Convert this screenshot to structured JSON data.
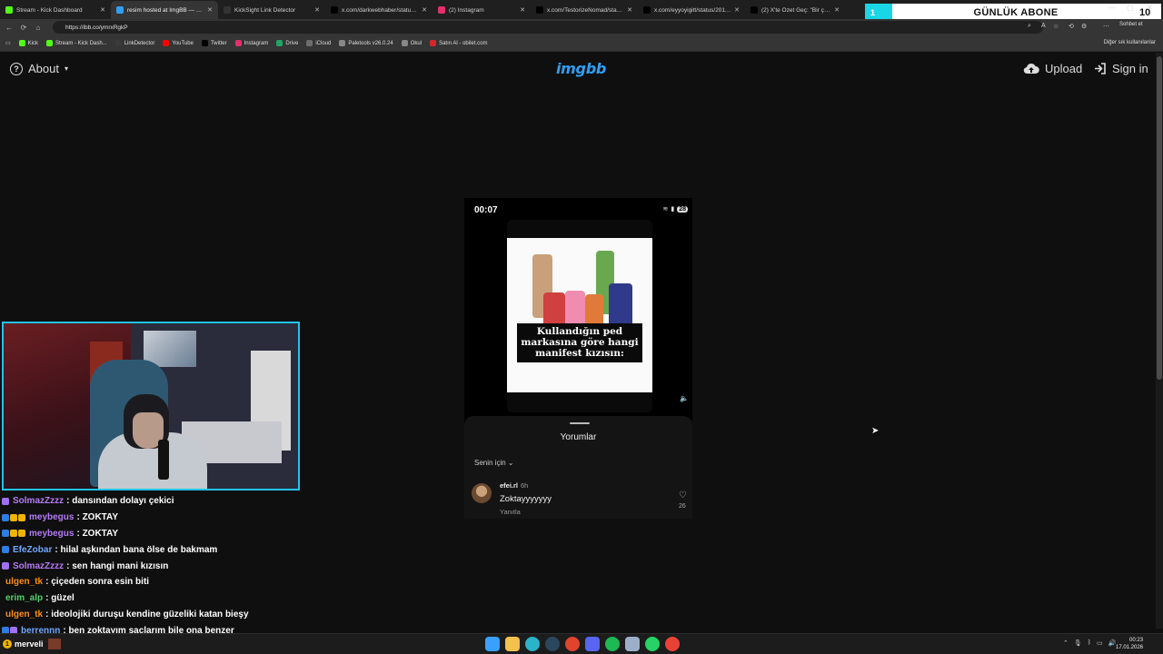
{
  "browser": {
    "tabs": [
      {
        "title": "Stream - Kick Dashboard",
        "fav_color": "#53fc18",
        "active": false
      },
      {
        "title": "resim hosted at ImgBB — ImgBB",
        "fav_color": "#2f9ff5",
        "active": true
      },
      {
        "title": "KickSight Link Detector",
        "fav_color": "#333333",
        "active": false
      },
      {
        "title": "x.com/darkwebhaber/status/2011",
        "fav_color": "#000000",
        "active": false
      },
      {
        "title": "(2) Instagram",
        "fav_color": "#e1306c",
        "active": false
      },
      {
        "title": "x.com/TestorizeNomad/status/201",
        "fav_color": "#000000",
        "active": false
      },
      {
        "title": "x.com/eyyoyigitt/status/2011378",
        "fav_color": "#000000",
        "active": false
      },
      {
        "title": "(2) X'te Özet Geç: \"Bir çift, \"Squid",
        "fav_color": "#000000",
        "active": false
      }
    ],
    "url": "https://ibb.co/ymrxRgkP",
    "sohbet_label": "Sohbet et",
    "bookmarks": [
      {
        "label": "Kick",
        "color": "#53fc18"
      },
      {
        "label": "Stream - Kick Dash...",
        "color": "#53fc18"
      },
      {
        "label": "LinkDetector",
        "color": "#3a3a3a"
      },
      {
        "label": "YouTube",
        "color": "#ff0000"
      },
      {
        "label": "Twitter",
        "color": "#000000"
      },
      {
        "label": "Instagram",
        "color": "#e1306c"
      },
      {
        "label": "Drive",
        "color": "#1fa463"
      },
      {
        "label": "iCloud",
        "color": "#6d6d6d"
      },
      {
        "label": "Paletools v26.0.24",
        "color": "#888888"
      },
      {
        "label": "Okul",
        "color": "#888888"
      },
      {
        "label": "Satın Al - obilet.com",
        "color": "#d6262d"
      }
    ],
    "other_bookmarks": "Diğer sık kullanılanlar"
  },
  "abone": {
    "label": "GÜNLÜK ABONE",
    "left_value": "1",
    "count": "10"
  },
  "imgbb": {
    "about_label": "About",
    "logo": "imgbb",
    "upload_label": "Upload",
    "signin_label": "Sign in"
  },
  "phone": {
    "time": "00:07",
    "battery": "28",
    "reel_caption": "Kullandığın ped markasına göre hangi manifest kızısın:",
    "sheet_title": "Yorumlar",
    "sort_label": "Senin için",
    "comment": {
      "user": "efei.rl",
      "time": "6h",
      "text": "Zoktayyyyyyy",
      "reply": "Yanıtla",
      "likes": "26"
    }
  },
  "chat": [
    {
      "user": "SolmazZzzz",
      "color": "#b57cf5",
      "text": ": dansından dolayı çekici",
      "badges": [
        "#a070f0"
      ]
    },
    {
      "user": "meybegus",
      "color": "#b57cf5",
      "text": ": ZOKTAY",
      "badges": [
        "#2f7de1",
        "#f0b400",
        "#f0b400"
      ]
    },
    {
      "user": "meybegus",
      "color": "#b57cf5",
      "text": ": ZOKTAY",
      "badges": [
        "#2f7de1",
        "#f0b400",
        "#f0b400"
      ]
    },
    {
      "user": "EfeZobar",
      "color": "#6fa8ff",
      "text": ": hilal aşkından bana ölse de bakmam",
      "badges": [
        "#2f7de1"
      ]
    },
    {
      "user": "SolmazZzzz",
      "color": "#b57cf5",
      "text": ": sen hangi mani kızısın",
      "badges": [
        "#a070f0"
      ]
    },
    {
      "user": "ulgen_tk",
      "color": "#ff8c1a",
      "text": ": çiçeden sonra esin biti",
      "badges": []
    },
    {
      "user": "erim_alp",
      "color": "#53d16b",
      "text": ": güzel",
      "badges": []
    },
    {
      "user": "ulgen_tk",
      "color": "#ff8c1a",
      "text": ": ideolojiki duruşu kendine güzeliki katan bieşy",
      "badges": []
    },
    {
      "user": "berrennn",
      "color": "#6fa8ff",
      "text": ": ben zoktayım saçlarım bile ona benzer",
      "badges": [
        "#2f7de1",
        "#a070f0"
      ]
    }
  ],
  "taskbar": {
    "weather_label": "merveli",
    "weather_temp": "1",
    "clock_time": "00:23",
    "clock_date": "17.01.2026",
    "apps": [
      {
        "name": "start",
        "color": "#3aa0ff"
      },
      {
        "name": "files",
        "color": "#f2c14e"
      },
      {
        "name": "edge",
        "color": "#2ab3c9"
      },
      {
        "name": "steam",
        "color": "#2a475e"
      },
      {
        "name": "record",
        "color": "#e0442e"
      },
      {
        "name": "discord",
        "color": "#5865f2"
      },
      {
        "name": "spotify",
        "color": "#1db954"
      },
      {
        "name": "app",
        "color": "#9bb0c8"
      },
      {
        "name": "whatsapp",
        "color": "#25d366"
      },
      {
        "name": "chrome",
        "color": "#e94235"
      }
    ]
  }
}
